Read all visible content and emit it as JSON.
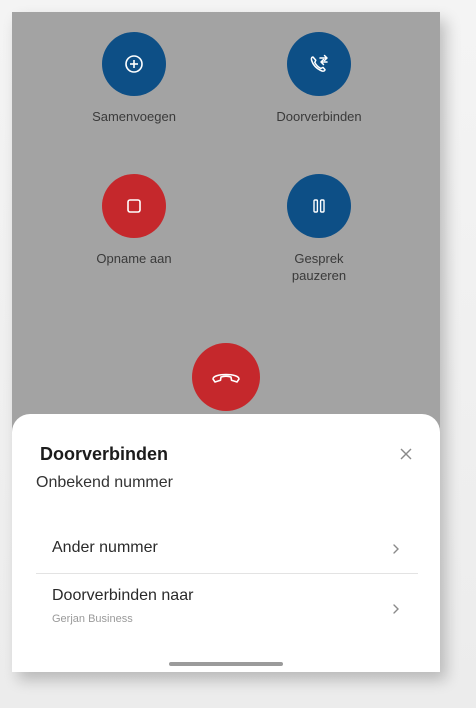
{
  "actions": {
    "merge": {
      "label": "Samenvoegen",
      "icon": "merge-icon",
      "color": "#0d4f86"
    },
    "transfer": {
      "label": "Doorverbinden",
      "icon": "transfer-call-icon",
      "color": "#0d4f86"
    },
    "record": {
      "label": "Opname aan",
      "icon": "record-stop-icon",
      "color": "#c5282c"
    },
    "hold": {
      "label": "Gesprek pauzeren",
      "icon": "pause-icon",
      "color": "#0d4f86"
    }
  },
  "end_call": {
    "icon": "hang-up-icon",
    "color": "#c5282c"
  },
  "sheet": {
    "title": "Doorverbinden",
    "subtitle": "Onbekend nummer",
    "close_icon": "close-icon",
    "options": [
      {
        "label": "Ander nummer",
        "sublabel": ""
      },
      {
        "label": "Doorverbinden naar",
        "sublabel": "Gerjan Business"
      }
    ]
  }
}
